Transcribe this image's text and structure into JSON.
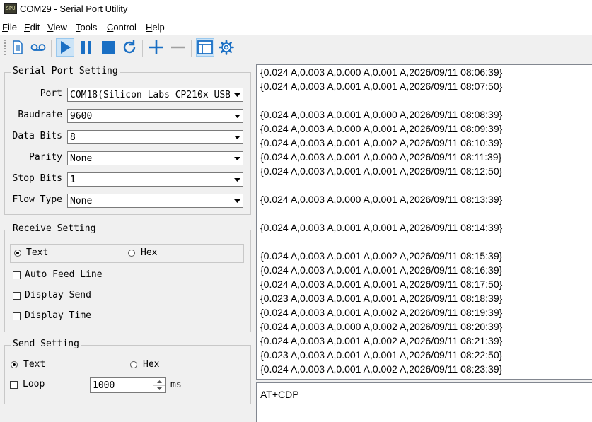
{
  "window": {
    "title": "COM29 - Serial Port Utility",
    "icon_text": "SPU"
  },
  "menu": [
    {
      "key": "F",
      "rest": "ile"
    },
    {
      "key": "E",
      "rest": "dit"
    },
    {
      "key": "V",
      "rest": "iew"
    },
    {
      "key": "T",
      "rest": "ools"
    },
    {
      "key": "C",
      "rest": "ontrol"
    },
    {
      "key": "H",
      "rest": "elp"
    }
  ],
  "serial_port": {
    "title": "Serial Port Setting",
    "port_label": "Port",
    "port_value": "COM18(Silicon Labs CP210x USB",
    "baud_label": "Baudrate",
    "baud_value": "9600",
    "databits_label": "Data Bits",
    "databits_value": "8",
    "parity_label": "Parity",
    "parity_value": "None",
    "stopbits_label": "Stop Bits",
    "stopbits_value": "1",
    "flow_label": "Flow Type",
    "flow_value": "None"
  },
  "receive": {
    "title": "Receive Setting",
    "text_label": "Text",
    "hex_label": "Hex",
    "selected": "Text",
    "auto_feed_label": "Auto Feed Line",
    "auto_feed_checked": false,
    "display_send_label": "Display Send",
    "display_send_checked": false,
    "display_time_label": "Display Time",
    "display_time_checked": false
  },
  "send": {
    "title": "Send Setting",
    "text_label": "Text",
    "hex_label": "Hex",
    "selected": "Text",
    "loop_label": "Loop",
    "loop_checked": false,
    "interval_value": "1000",
    "interval_unit": "ms"
  },
  "output_lines": [
    "{0.024 A,0.003 A,0.000 A,0.001 A,2026/09/11 08:06:39}",
    "{0.024 A,0.003 A,0.001 A,0.001 A,2026/09/11 08:07:50}",
    "",
    "{0.024 A,0.003 A,0.001 A,0.000 A,2026/09/11 08:08:39}",
    "{0.024 A,0.003 A,0.000 A,0.001 A,2026/09/11 08:09:39}",
    "{0.024 A,0.003 A,0.001 A,0.002 A,2026/09/11 08:10:39}",
    "{0.024 A,0.003 A,0.001 A,0.000 A,2026/09/11 08:11:39}",
    "{0.024 A,0.003 A,0.001 A,0.001 A,2026/09/11 08:12:50}",
    "",
    "{0.024 A,0.003 A,0.000 A,0.001 A,2026/09/11 08:13:39}",
    "",
    "{0.024 A,0.003 A,0.001 A,0.001 A,2026/09/11 08:14:39}",
    "",
    "{0.024 A,0.003 A,0.001 A,0.002 A,2026/09/11 08:15:39}",
    "{0.024 A,0.003 A,0.001 A,0.001 A,2026/09/11 08:16:39}",
    "{0.024 A,0.003 A,0.001 A,0.001 A,2026/09/11 08:17:50}",
    "{0.023 A,0.003 A,0.001 A,0.001 A,2026/09/11 08:18:39}",
    "{0.024 A,0.003 A,0.001 A,0.002 A,2026/09/11 08:19:39}",
    "{0.024 A,0.003 A,0.000 A,0.002 A,2026/09/11 08:20:39}",
    "{0.024 A,0.003 A,0.001 A,0.002 A,2026/09/11 08:21:39}",
    "{0.023 A,0.003 A,0.001 A,0.001 A,2026/09/11 08:22:50}",
    "{0.024 A,0.003 A,0.001 A,0.002 A,2026/09/11 08:23:39}"
  ],
  "input_text": "AT+CDP",
  "toolbar": {
    "icons": [
      "new-document-icon",
      "record-icon",
      "start-icon",
      "pause-icon",
      "stop-icon",
      "refresh-icon",
      "add-icon",
      "remove-icon",
      "layout-icon",
      "settings-icon"
    ],
    "accent_color": "#1a6fc4"
  }
}
